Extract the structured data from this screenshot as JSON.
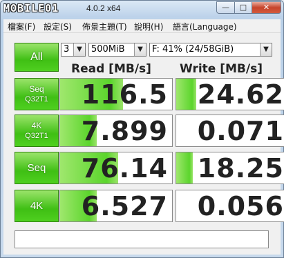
{
  "title_bar": {
    "logo_text": "MOBILE01",
    "version": "4.0.2 x64",
    "minimize": "—",
    "maximize": "□",
    "close": "✕"
  },
  "menu": {
    "items": [
      "檔案(F)",
      "設定(S)",
      "佈景主題(T)",
      "說明(H)",
      "語言(Language)"
    ]
  },
  "controls": {
    "all_label": "All",
    "runs": "3",
    "size": "500MiB",
    "drive": "F: 41% (24/58GiB)"
  },
  "headers": {
    "read": "Read [MB/s]",
    "write": "Write [MB/s]"
  },
  "rows": [
    {
      "label1": "Seq",
      "label2": "Q32T1",
      "read": "116.5",
      "write": "24.62",
      "read_fill": 0.56,
      "write_fill": 0.18
    },
    {
      "label1": "4K",
      "label2": "Q32T1",
      "read": "7.899",
      "write": "0.071",
      "read_fill": 0.33,
      "write_fill": 0.0
    },
    {
      "label1": "Seq",
      "label2": "",
      "read": "76.14",
      "write": "18.25",
      "read_fill": 0.52,
      "write_fill": 0.15
    },
    {
      "label1": "4K",
      "label2": "",
      "read": "6.527",
      "write": "0.056",
      "read_fill": 0.33,
      "write_fill": 0.0
    }
  ],
  "comment": "",
  "colors": {
    "accent_green": "#3fbf14",
    "bar_green": "#5bd52c"
  }
}
